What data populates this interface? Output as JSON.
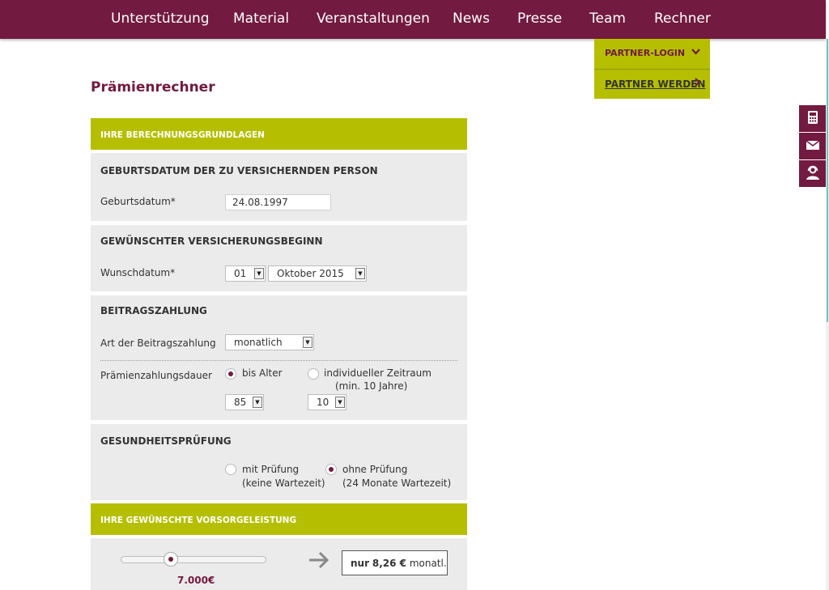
{
  "nav": {
    "items": [
      "Unterstützung",
      "Material",
      "Veranstaltungen",
      "News",
      "Presse",
      "Team",
      "Rechner"
    ]
  },
  "partner": {
    "login": "PARTNER-LOGIN",
    "werden": "PARTNER WERDEN"
  },
  "side_tools": [
    "calculator-icon",
    "mail-icon",
    "support-agent-icon"
  ],
  "page_title": "Prämienrechner",
  "section_main": "IHRE BERECHNUNGSGRUNDLAGEN",
  "birth": {
    "heading": "GEBURTSDATUM DER ZU VERSICHERNDEN PERSON",
    "label": "Geburtsdatum*",
    "value": "24.08.1997"
  },
  "start": {
    "heading": "GEWÜNSCHTER VERSICHERUNGSBEGINN",
    "label": "Wunschdatum*",
    "day": "01",
    "month": "Oktober 2015"
  },
  "payment": {
    "heading": "BEITRAGSZAHLUNG",
    "type_label": "Art der Beitragszahlung",
    "type_value": "monatlich",
    "duration_label": "Prämienzahlungsdauer",
    "option_age": "bis Alter",
    "option_individual": "individueller Zeitraum",
    "option_individual_note": "(min. 10 Jahre)",
    "age_value": "85",
    "years_value": "10",
    "selected": "bis Alter"
  },
  "health": {
    "heading": "GESUNDHEITSPRÜFUNG",
    "option_with": "mit Prüfung",
    "option_with_note": "(keine Wartezeit)",
    "option_without": "ohne Prüfung",
    "option_without_note": "(24 Monate Wartezeit)",
    "selected": "ohne Prüfung"
  },
  "benefit": {
    "heading": "IHRE GEWÜNSCHTE VORSORGELEISTUNG",
    "amount": "7.000€",
    "result_prefix": "nur",
    "result_value": "8,26 €",
    "result_suffix": "monatl."
  },
  "colors": {
    "brand": "#721a3f",
    "accent": "#b5bf00",
    "panel": "#ebebeb"
  }
}
